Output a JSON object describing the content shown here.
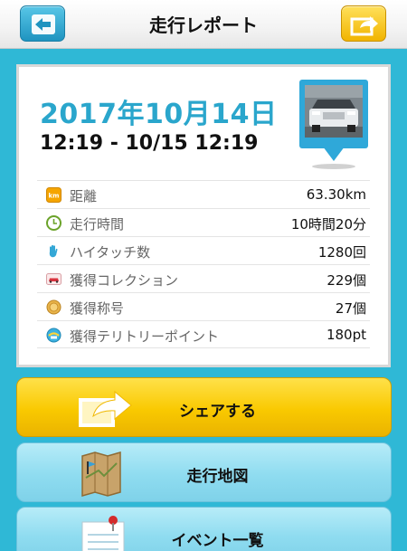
{
  "header": {
    "title": "走行レポート",
    "back_icon": "back-arrow-icon",
    "share_icon": "share-arrow-icon"
  },
  "report": {
    "date": "2017年10月14日",
    "time_range": "12:19 - 10/15 12:19"
  },
  "stats": [
    {
      "icon": "distance-km-icon",
      "label": "距離",
      "value": "63.30km"
    },
    {
      "icon": "clock-icon",
      "label": "走行時間",
      "value": "10時間20分"
    },
    {
      "icon": "hand-icon",
      "label": "ハイタッチ数",
      "value": "1280回"
    },
    {
      "icon": "car-collection-icon",
      "label": "獲得コレクション",
      "value": "229個"
    },
    {
      "icon": "medal-icon",
      "label": "獲得称号",
      "value": "27個"
    },
    {
      "icon": "territory-point-icon",
      "label": "獲得テリトリーポイント",
      "value": "180pt"
    }
  ],
  "buttons": {
    "share": "シェアする",
    "map": "走行地図",
    "events": "イベント一覧"
  },
  "colors": {
    "background": "#2fb8d6",
    "date": "#2aa6cc",
    "share_button": "#f9c900",
    "light_button": "#8fdcf0"
  }
}
